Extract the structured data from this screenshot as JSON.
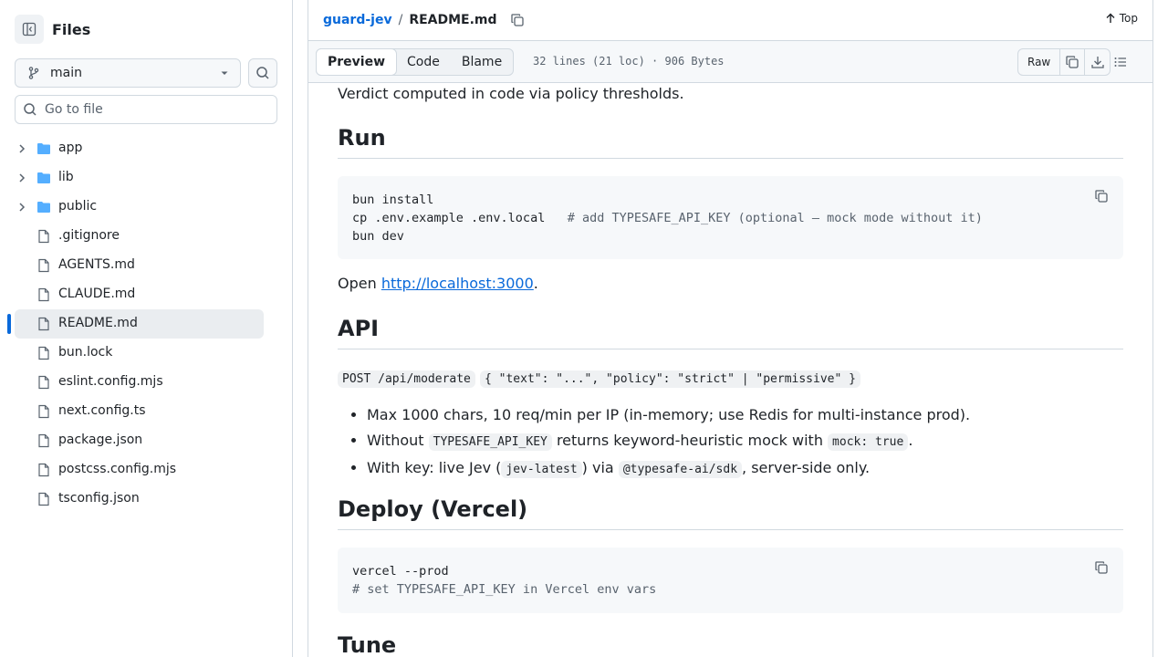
{
  "sidebar": {
    "title": "Files",
    "branch": "main",
    "goto_placeholder": "Go to file",
    "items": [
      {
        "name": "app",
        "type": "folder"
      },
      {
        "name": "lib",
        "type": "folder"
      },
      {
        "name": "public",
        "type": "folder"
      },
      {
        "name": ".gitignore",
        "type": "file"
      },
      {
        "name": "AGENTS.md",
        "type": "file"
      },
      {
        "name": "CLAUDE.md",
        "type": "file"
      },
      {
        "name": "README.md",
        "type": "file",
        "active": true
      },
      {
        "name": "bun.lock",
        "type": "file"
      },
      {
        "name": "eslint.config.mjs",
        "type": "file"
      },
      {
        "name": "next.config.ts",
        "type": "file"
      },
      {
        "name": "package.json",
        "type": "file"
      },
      {
        "name": "postcss.config.mjs",
        "type": "file"
      },
      {
        "name": "tsconfig.json",
        "type": "file"
      }
    ]
  },
  "header": {
    "repo": "guard-jev",
    "separator": "/",
    "file": "README.md",
    "top_label": "Top"
  },
  "toolbar": {
    "tabs": [
      "Preview",
      "Code",
      "Blame"
    ],
    "active_tab": "Preview",
    "meta": "32 lines (21 loc) · 906 Bytes",
    "raw_label": "Raw"
  },
  "readme": {
    "verdict_line": "Verdict computed in code via policy thresholds.",
    "run_heading": "Run",
    "run_code": {
      "line1": "bun install",
      "line2": "cp .env.example .env.local   ",
      "line2_comment": "# add TYPESAFE_API_KEY (optional — mock mode without it)",
      "line3": "bun dev"
    },
    "open_prefix": "Open ",
    "open_link": "http://localhost:3000",
    "open_suffix": ".",
    "api_heading": "API",
    "api_endpoint": "POST /api/moderate",
    "api_body": "{ \"text\": \"...\", \"policy\": \"strict\" | \"permissive\" }",
    "bullet1": "Max 1000 chars, 10 req/min per IP (in-memory; use Redis for multi-instance prod).",
    "bullet2_a": "Without ",
    "bullet2_code1": "TYPESAFE_API_KEY",
    "bullet2_b": " returns keyword-heuristic mock with ",
    "bullet2_code2": "mock: true",
    "bullet2_c": ".",
    "bullet3_a": "With key: live Jev (",
    "bullet3_code1": "jev-latest",
    "bullet3_b": ") via ",
    "bullet3_code2": "@typesafe-ai/sdk",
    "bullet3_c": ", server-side only.",
    "deploy_heading": "Deploy (Vercel)",
    "deploy_code": {
      "line1": "vercel --prod",
      "line2": "# set TYPESAFE_API_KEY in Vercel env vars"
    },
    "tune_heading": "Tune"
  }
}
